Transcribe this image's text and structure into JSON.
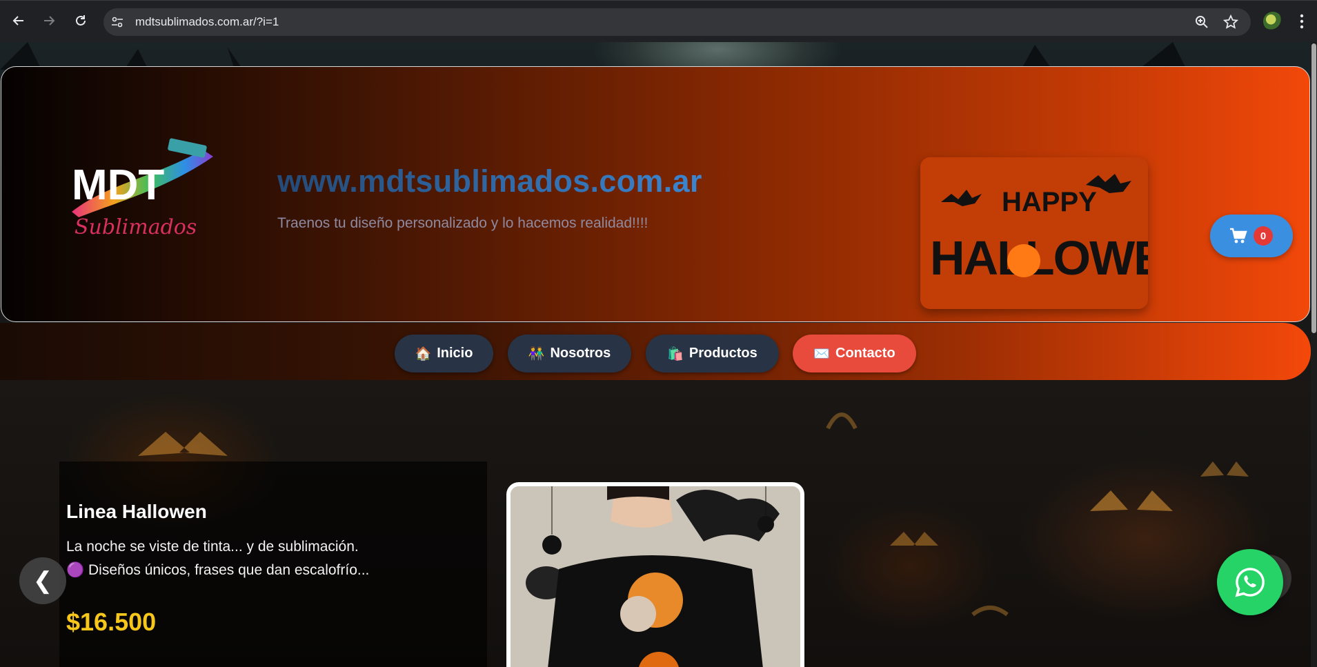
{
  "browser": {
    "url": "mdtsublimados.com.ar/?i=1",
    "icons": [
      "back-arrow-icon",
      "forward-arrow-icon",
      "reload-icon",
      "site-info-icon",
      "zoom-icon",
      "bookmark-star-icon",
      "profile-avatar",
      "more-menu-icon"
    ]
  },
  "header": {
    "logo_text": "MDT",
    "logo_subtext": "Sublimados",
    "site_title": "www.mdtsublimados.com.ar",
    "tagline": "Traenos tu diseño personalizado y lo hacemos realidad!!!!",
    "halloween_banner": {
      "line1": "HAPPY",
      "line2": "HALLOWEEN"
    },
    "cart_count": "0"
  },
  "nav": {
    "items": [
      {
        "emoji": "🏠",
        "label": "Inicio"
      },
      {
        "emoji": "👫",
        "label": "Nosotros"
      },
      {
        "emoji": "🛍️",
        "label": "Productos"
      },
      {
        "emoji": "✉️",
        "label": "Contacto"
      }
    ]
  },
  "hero": {
    "product_name": "Linea Hallowen",
    "description_line1": "La noche se viste de tinta... y de sublimación.",
    "description_line2": "Diseños únicos, frases que dan escalofrío...",
    "description_bullet_emoji": "🟣",
    "price": "$16.500",
    "prev_label": "❮"
  },
  "colors": {
    "accent_red": "#e84a3c",
    "nav_pill": "#283446",
    "cart_blue": "#3b8fe0",
    "price_yellow": "#f7c61a",
    "whatsapp_green": "#25d366",
    "title_blue": "#2f73b4"
  }
}
